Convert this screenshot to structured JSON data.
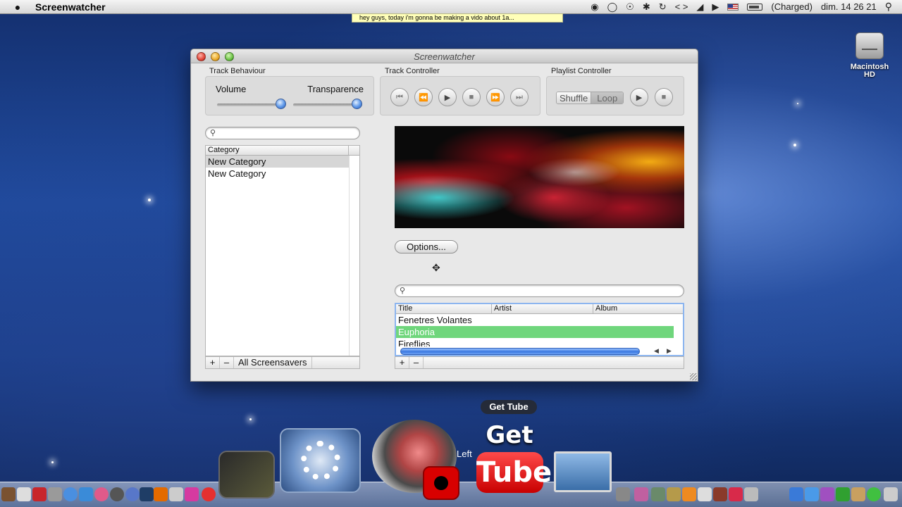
{
  "menubar": {
    "app_name": "Screenwatcher",
    "battery_status": "(Charged)",
    "clock": "dim. 14 26 21",
    "input_menu": "< >"
  },
  "notification_tooltip": "hey guys, today i'm gonna be making a vido about 1a...",
  "desktop": {
    "hd_label_line1": "Macintosh",
    "hd_label_line2": "HD"
  },
  "window": {
    "title": "Screenwatcher",
    "track_behaviour": {
      "label": "Track Behaviour",
      "volume_label": "Volume",
      "transparence_label": "Transparence",
      "volume_level": 1.0,
      "transparence_level": 1.0
    },
    "track_controller": {
      "label": "Track Controller",
      "buttons": [
        "first-track-icon",
        "rewind-icon",
        "play-icon",
        "stop-icon",
        "fast-forward-icon",
        "last-track-icon"
      ]
    },
    "playlist_controller": {
      "label": "Playlist Controller",
      "shuffle_label": "Shuffle",
      "loop_label": "Loop"
    },
    "category_panel": {
      "header": "Category",
      "items": [
        "New Category",
        "New Category"
      ],
      "bottom_label": "All Screensavers"
    },
    "options_label": "Options...",
    "tracks_panel": {
      "headers": [
        "Title",
        "Artist",
        "Album"
      ],
      "rows": [
        "Fenetres Volantes",
        "Euphoria",
        "Fireflies"
      ],
      "selected_row": "Euphoria"
    },
    "add_symbol": "+",
    "remove_symbol": "–"
  },
  "dock": {
    "tooltip": "Get Tube",
    "get_text": "Get",
    "tube_text": "Tube",
    "left_label": "Left"
  },
  "colors": {
    "selection_green": "#6fd67c",
    "accent_blue": "#3a78e0"
  }
}
